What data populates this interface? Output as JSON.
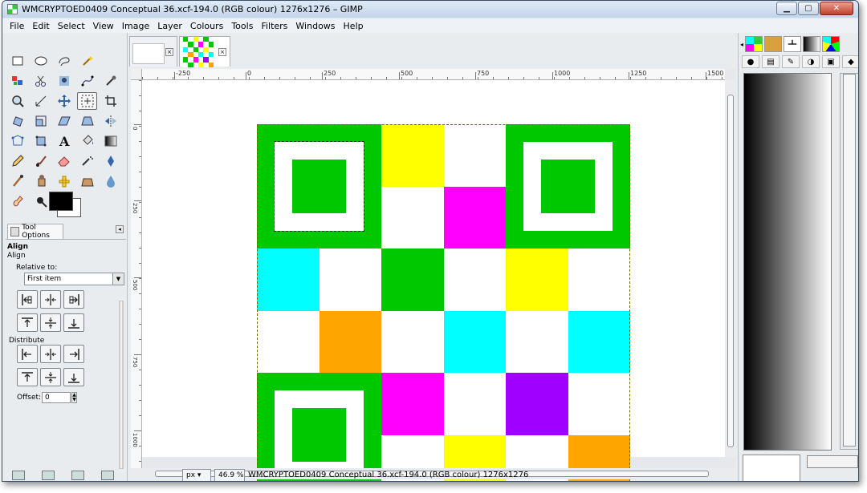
{
  "window": {
    "title": "WMCRYPTOED0409 Conceptual 36.xcf-194.0 (RGB colour) 1276x1276 – GIMP",
    "controls": [
      "minimize",
      "maximize",
      "close"
    ]
  },
  "menubar": [
    "File",
    "Edit",
    "Select",
    "View",
    "Image",
    "Layer",
    "Colours",
    "Tools",
    "Filters",
    "Windows",
    "Help"
  ],
  "toolbox": {
    "tools": [
      "rect-select",
      "ellipse-select",
      "free-select",
      "fuzzy-select",
      "",
      "select-by-color",
      "scissors-select",
      "foreground-select",
      "paths",
      "color-picker",
      "zoom",
      "measure",
      "move",
      "align",
      "crop",
      "rotate",
      "scale",
      "shear",
      "perspective",
      "flip",
      "cage-transform",
      "unified-transform",
      "text",
      "bucket-fill",
      "blend",
      "pencil",
      "paintbrush",
      "eraser",
      "airbrush",
      "ink",
      "mypaint-brush",
      "clone",
      "heal",
      "perspective-clone",
      "blur-sharpen",
      "smudge",
      "dodge-burn"
    ],
    "active_tool": "align",
    "tool_options": {
      "tab_label": "Tool Options",
      "heading": "Align",
      "subheading": "Align",
      "relative_to_label": "Relative to:",
      "relative_to_value": "First item",
      "distribute_label": "Distribute",
      "offset_label": "Offset:",
      "offset_value": "0"
    }
  },
  "rulers": {
    "horizontal": [
      "-250",
      "0",
      "250",
      "500",
      "750",
      "1000",
      "1250",
      "1500"
    ],
    "vertical": [
      "0",
      "250",
      "500",
      "750",
      "1000"
    ]
  },
  "statusbar": {
    "unit": "px",
    "zoom": "46.9 %",
    "text": "WMCRYPTOED0409 Conceptual 36.xcf-194.0 (RGB colour) 1276x1276"
  },
  "image_grid": {
    "rows": 6,
    "cols": 6,
    "colors": {
      "W": "#ffffff",
      "G": "#00c800",
      "Y": "#ffff00",
      "M": "#ff00ff",
      "C": "#00ffff",
      "O": "#ffa500",
      "P": "#a000ff"
    },
    "cells": [
      [
        "F1",
        "F1",
        "Y",
        "W",
        "F2",
        "F2"
      ],
      [
        "F1",
        "F1",
        "W",
        "M",
        "F2",
        "F2"
      ],
      [
        "C",
        "W",
        "G",
        "W",
        "Y",
        "W"
      ],
      [
        "W",
        "O",
        "W",
        "C",
        "W",
        "C"
      ],
      [
        "F3",
        "F3",
        "M",
        "W",
        "P",
        "W"
      ],
      [
        "F3",
        "F3",
        "W",
        "Y",
        "W",
        "O"
      ]
    ]
  },
  "dock": {
    "tabs": [
      "layers",
      "channels",
      "paths",
      "gradient",
      "palette"
    ],
    "subtabs": [
      "brushes",
      "patterns",
      "fonts",
      "gradients",
      "palettes",
      "colors"
    ]
  }
}
